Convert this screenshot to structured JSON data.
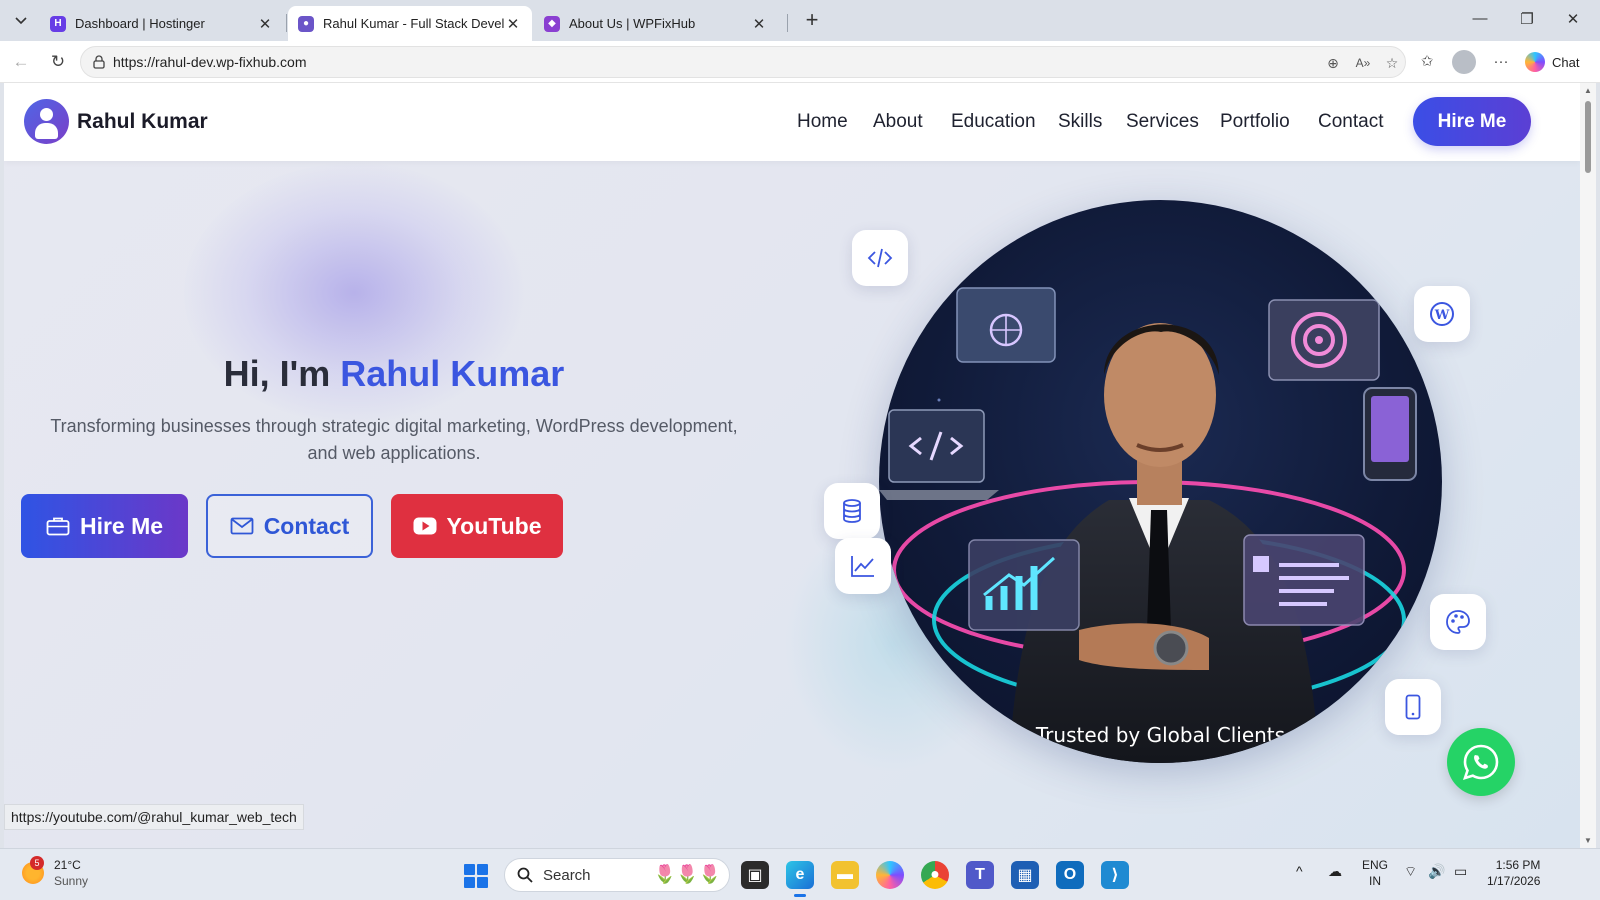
{
  "browser": {
    "tabs": [
      {
        "title": "Dashboard | Hostinger",
        "active": false
      },
      {
        "title": "Rahul Kumar - Full Stack Developer",
        "active": true
      },
      {
        "title": "About Us | WPFixHub",
        "active": false
      }
    ],
    "url": "https://rahul-dev.wp-fixhub.com",
    "chat_label": "Chat",
    "status_url": "https://youtube.com/@rahul_kumar_web_tech"
  },
  "site": {
    "brand_name": "Rahul Kumar",
    "nav": [
      "Home",
      "About",
      "Education",
      "Skills",
      "Services",
      "Portfolio",
      "Contact"
    ],
    "hire_button": "Hire Me"
  },
  "hero": {
    "greeting": "Hi, I'm",
    "name": "Rahul Kumar",
    "subtitle": "Transforming businesses through strategic digital marketing, WordPress development, and web applications.",
    "buttons": {
      "hire": "Hire Me",
      "contact": "Contact",
      "youtube": "YouTube"
    },
    "image_caption": "Trusted by Global Clients",
    "floating_icons": [
      "code-icon",
      "wordpress-icon",
      "database-icon",
      "chart-icon",
      "palette-icon",
      "mobile-icon"
    ]
  },
  "colors": {
    "accent": "#3b56e0",
    "purple": "#6b38c8",
    "youtube": "#df3040",
    "whatsapp": "#25d366"
  },
  "taskbar": {
    "weather_temp": "21°C",
    "weather_desc": "Sunny",
    "weather_badge": "5",
    "search_label": "Search",
    "lang_1": "ENG",
    "lang_2": "IN",
    "time": "1:56 PM",
    "date": "1/17/2026"
  }
}
